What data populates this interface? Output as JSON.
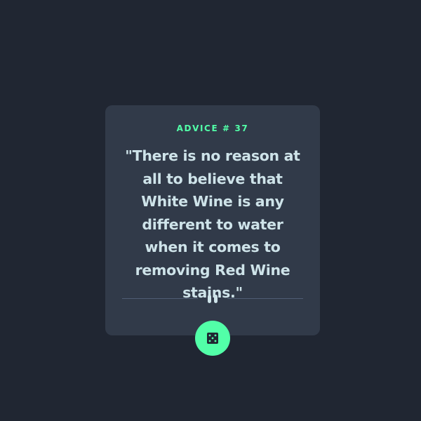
{
  "advice": {
    "label": "ADVICE # 37",
    "quote": "\"There is no reason at all to believe that White Wine is any different to water when it comes to removing Red Wine stains.\""
  },
  "icons": {
    "divider": "pause-icon",
    "button": "dice-icon"
  },
  "colors": {
    "background": "#202632",
    "card": "#313a49",
    "accent": "#52ffa8",
    "text": "#cee3e9",
    "divider": "#4f5d74"
  }
}
